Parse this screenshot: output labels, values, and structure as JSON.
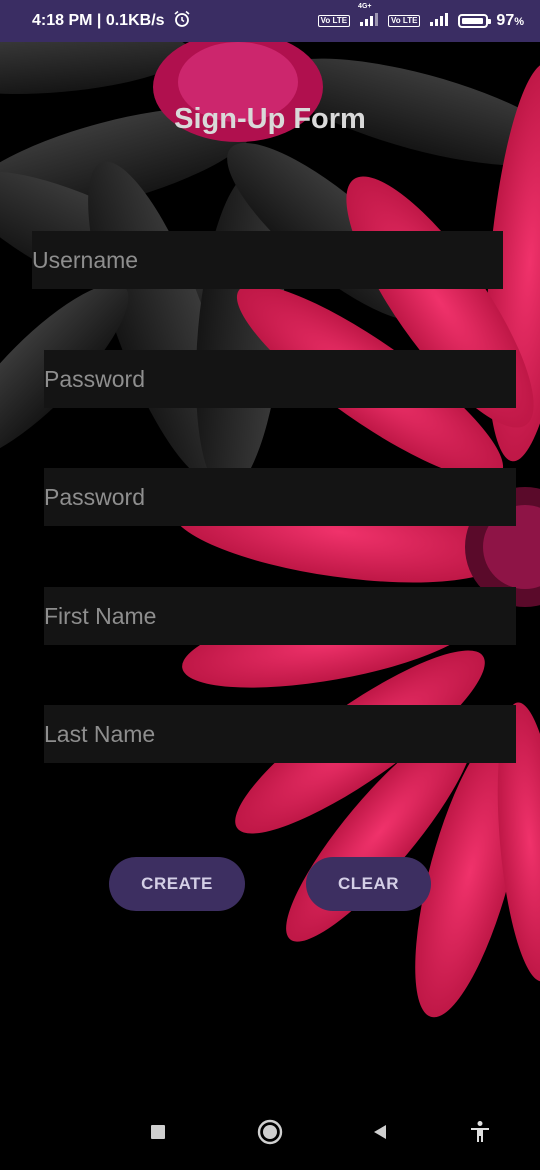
{
  "status_bar": {
    "time_speed": "4:18 PM | 0.1KB/s",
    "alarm_icon": "alarm-clock-icon",
    "volte1": "Vo LTE",
    "network_label": "4G+",
    "volte2": "Vo LTE",
    "battery_percent": "97",
    "battery_unit": "%",
    "battery_level": 0.97
  },
  "form": {
    "title": "Sign-Up Form",
    "fields": [
      {
        "placeholder": "Username",
        "value": ""
      },
      {
        "placeholder": "Password",
        "value": ""
      },
      {
        "placeholder": "Password",
        "value": ""
      },
      {
        "placeholder": "First Name",
        "value": ""
      },
      {
        "placeholder": "Last Name",
        "value": ""
      }
    ],
    "create_label": "CREATE",
    "clear_label": "CLEAR"
  },
  "nav": {
    "recents_icon": "square-icon",
    "home_icon": "circle-icon",
    "back_icon": "triangle-back-icon",
    "accessibility_icon": "accessibility-icon"
  },
  "colors": {
    "accent": "#3d2f61",
    "status_bar": "#3a2d63",
    "field_bg": "#141414",
    "flower_pink": "#e0195a"
  }
}
